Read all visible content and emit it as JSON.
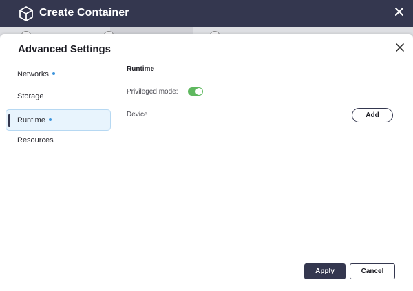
{
  "window": {
    "title": "Create Container",
    "icon": "cube-icon",
    "close_icon": "close-icon"
  },
  "dialog": {
    "title": "Advanced Settings",
    "close_icon": "close-icon"
  },
  "sidebar": {
    "items": [
      {
        "label": "Networks",
        "modified": true,
        "active": false
      },
      {
        "label": "Storage",
        "modified": false,
        "active": false
      },
      {
        "label": "Runtime",
        "modified": true,
        "active": true
      },
      {
        "label": "Resources",
        "modified": false,
        "active": false
      }
    ]
  },
  "runtime": {
    "section_title": "Runtime",
    "privileged_label": "Privileged mode:",
    "privileged_enabled": true,
    "device_label": "Device",
    "add_label": "Add"
  },
  "footer": {
    "apply_label": "Apply",
    "cancel_label": "Cancel"
  },
  "colors": {
    "titlebar": "#34374f",
    "accent_dot": "#3d94dc",
    "toggle_on": "#5fb85f",
    "active_nav_bg": "#e8f4fd"
  }
}
